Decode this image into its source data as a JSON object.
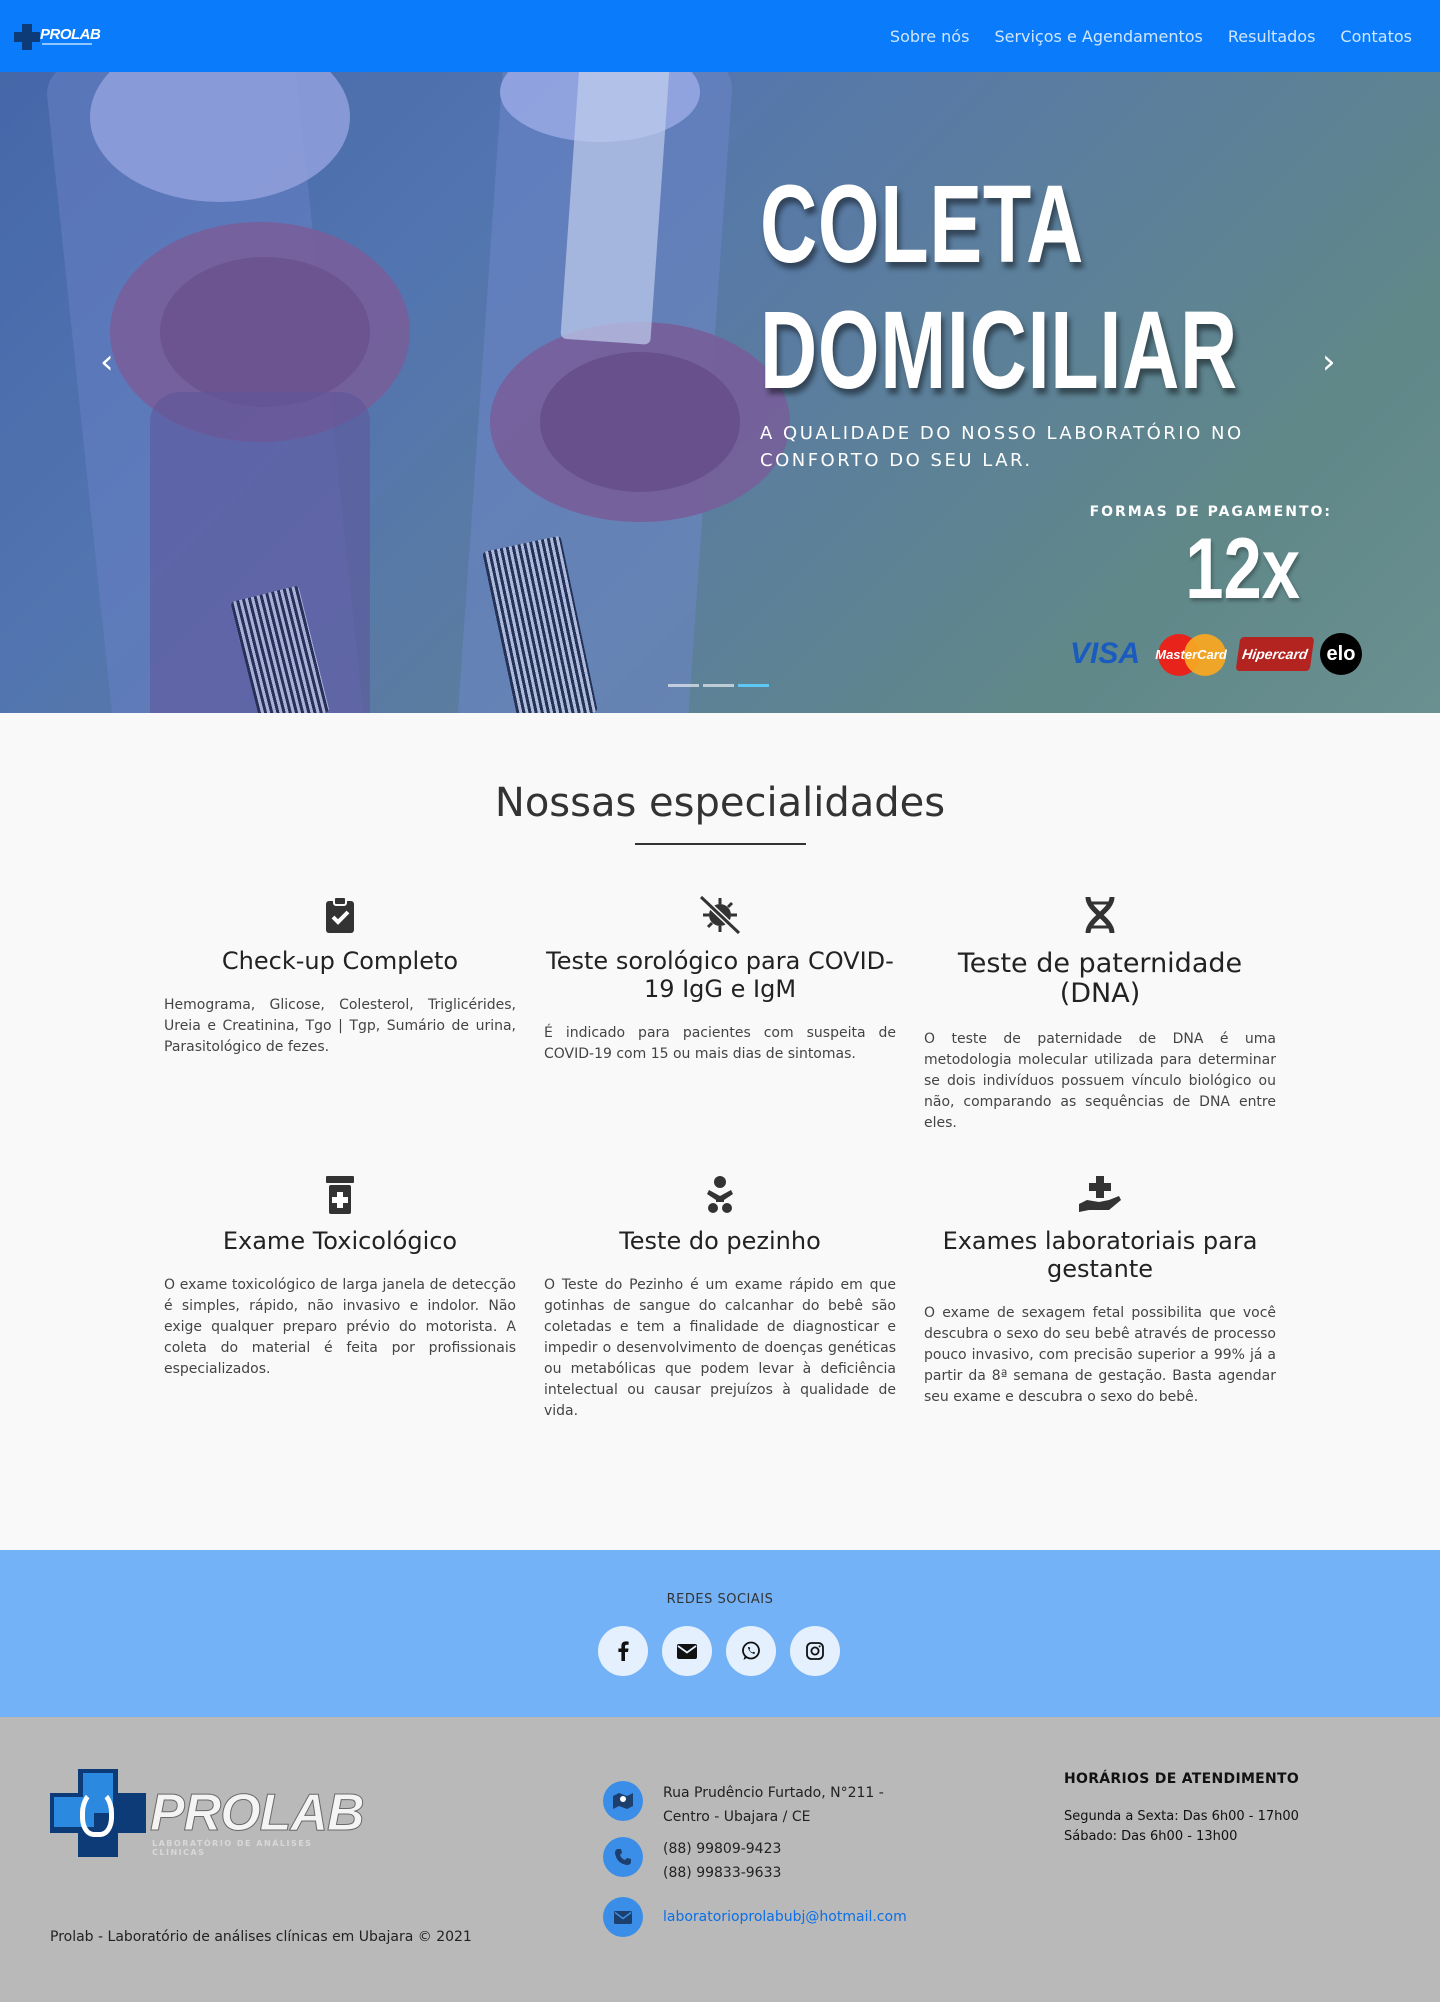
{
  "nav": {
    "logo_text": "PROLAB",
    "links": [
      "Sobre nós",
      "Serviços e Agendamentos",
      "Resultados",
      "Contatos"
    ]
  },
  "hero": {
    "title_line1": "COLETA",
    "title_line2": "DOMICILIAR",
    "subtitle": "A qualidade do nosso laboratório no conforto do seu lar.",
    "payment_label": "FORMAS DE PAGAMENTO:",
    "installments": "12x",
    "cards": [
      "VISA",
      "MasterCard",
      "Hipercard",
      "elo"
    ],
    "prev_arrow": "‹",
    "next_arrow": "›",
    "slides_count": 3,
    "active_slide": 3
  },
  "specialties": {
    "title": "Nossas especialidades",
    "items": [
      {
        "icon": "clipboard-check-icon",
        "name": "Check-up Completo",
        "desc": "Hemograma, Glicose, Colesterol, Triglicérides, Ureia e Creatinina, Tgo | Tgp, Sumário de urina, Parasitológico de fezes."
      },
      {
        "icon": "virus-slash-icon",
        "name": "Teste sorológico para COVID-19 IgG e IgM",
        "desc": "É indicado para pacientes com suspeita de COVID-19 com 15 ou mais dias de sintomas."
      },
      {
        "icon": "dna-icon",
        "name": "Teste de paternidade (DNA)",
        "desc": "O teste de paternidade de DNA é uma metodologia molecular utilizada para determinar se dois indivíduos possuem vínculo biológico ou não, comparando as sequências de DNA entre eles."
      },
      {
        "icon": "prescription-bottle-icon",
        "name": "Exame Toxicológico",
        "desc": "O exame toxicológico de larga janela de detecção é simples, rápido, não invasivo e indolor. Não exige qualquer preparo prévio do motorista. A coleta do material é feita por profissionais especializados."
      },
      {
        "icon": "baby-icon",
        "name": "Teste do pezinho",
        "desc": "O Teste do Pezinho é um exame rápido em que gotinhas de sangue do calcanhar do bebê são coletadas e tem a finalidade de diagnosticar e impedir o desenvolvimento de doenças genéticas ou metabólicas que podem levar à deficiência intelectual ou causar prejuízos à qualidade de vida."
      },
      {
        "icon": "hand-holding-medical-icon",
        "name": "Exames laboratoriais para gestante",
        "desc": "O exame de sexagem fetal possibilita que você descubra o sexo do seu bebê através de processo pouco invasivo, com precisão superior a 99% já a partir da 8ª semana de gestação. Basta agendar seu exame e descubra o sexo do bebê."
      }
    ]
  },
  "social": {
    "title": "REDES SOCIAIS",
    "icons": [
      "facebook-icon",
      "email-icon",
      "whatsapp-icon",
      "instagram-icon"
    ]
  },
  "footer": {
    "logo_text": "PROLAB",
    "logo_sub": "LABORATÓRIO DE ANÁLISES CLÍNICAS",
    "copyright": "Prolab - Laboratório de análises clínicas em Ubajara © 2021",
    "address_line1": "Rua Prudêncio Furtado, N°211 -",
    "address_line2": "Centro - Ubajara / CE",
    "phone1": "(88) 99809-9423",
    "phone2": "(88) 99833-9633",
    "email": "laboratorioprolabubj@hotmail.com",
    "hours_title": "HORÁRIOS DE ATENDIMENTO",
    "hours_weekdays": "Segunda a Sexta: Das 6h00 - 17h00",
    "hours_saturday": "Sábado: Das 6h00 - 13h00"
  }
}
